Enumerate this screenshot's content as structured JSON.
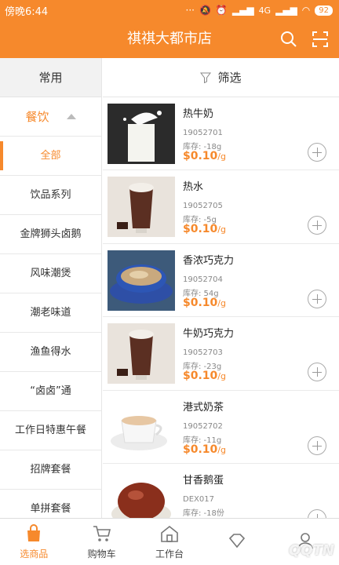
{
  "status_bar": {
    "time": "傍晚6:44",
    "network": "4G",
    "battery": "92"
  },
  "header": {
    "title": "祺祺大都市店"
  },
  "sidebar": {
    "common": "常用",
    "category": "餐饮",
    "items": [
      {
        "label": "全部",
        "active": true
      },
      {
        "label": "饮品系列"
      },
      {
        "label": "金牌狮头卤鹅"
      },
      {
        "label": "风味潮煲"
      },
      {
        "label": "潮老味道"
      },
      {
        "label": "渔鱼得水"
      },
      {
        "label": "“卤卤”通"
      },
      {
        "label": "工作日特惠午餐"
      },
      {
        "label": "招牌套餐"
      },
      {
        "label": "单拼套餐"
      }
    ]
  },
  "filter": {
    "label": "筛选"
  },
  "products": [
    {
      "name": "热牛奶",
      "code": "19052701",
      "stock": "库存: -18g",
      "price": "$0.10",
      "unit": "/g"
    },
    {
      "name": "热水",
      "code": "19052705",
      "stock": "库存: -5g",
      "price": "$0.10",
      "unit": "/g"
    },
    {
      "name": "香浓巧克力",
      "code": "19052704",
      "stock": "库存: 54g",
      "price": "$0.10",
      "unit": "/g"
    },
    {
      "name": "牛奶巧克力",
      "code": "19052703",
      "stock": "库存: -23g",
      "price": "$0.10",
      "unit": "/g"
    },
    {
      "name": "港式奶茶",
      "code": "19052702",
      "stock": "库存: -11g",
      "price": "$0.10",
      "unit": "/g"
    },
    {
      "name": "甘香鹅蛋",
      "code": "DEX017",
      "stock": "库存: -18份",
      "price": "",
      "unit": ""
    }
  ],
  "tabbar": {
    "items": [
      {
        "label": "选商品",
        "icon": "bag-icon",
        "active": true
      },
      {
        "label": "购物车",
        "icon": "cart-icon"
      },
      {
        "label": "工作台",
        "icon": "home-icon"
      },
      {
        "label": "",
        "icon": "diamond-icon"
      },
      {
        "label": "",
        "icon": "user-icon"
      }
    ]
  },
  "watermark": "QQTN"
}
